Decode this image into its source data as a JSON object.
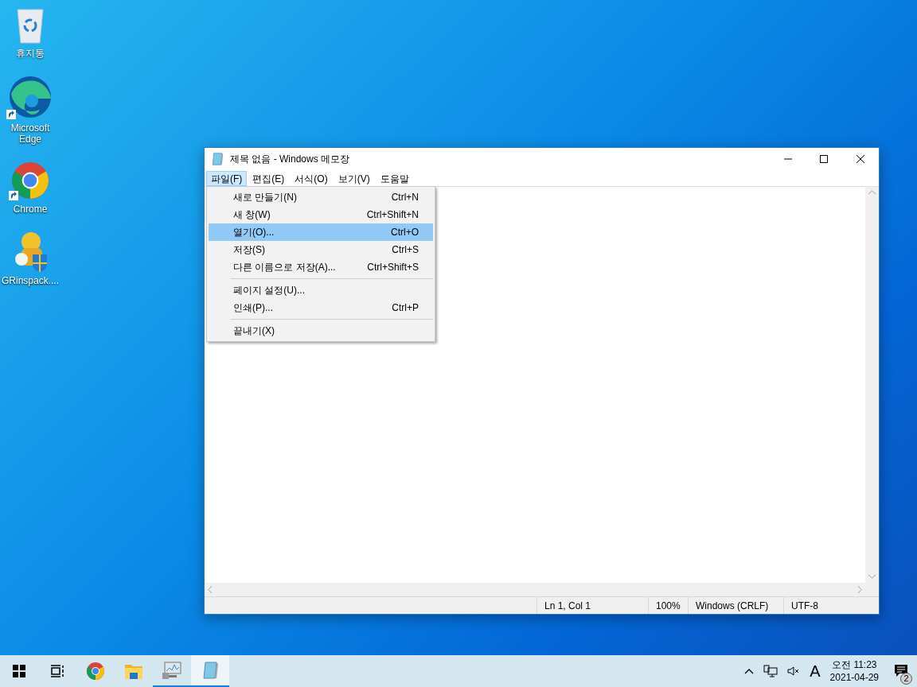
{
  "desktop_icons": [
    {
      "kind": "recycle",
      "label": "휴지통",
      "shortcut": false
    },
    {
      "kind": "edge",
      "label": "Microsoft Edge",
      "shortcut": true
    },
    {
      "kind": "chrome",
      "label": "Chrome",
      "shortcut": true
    },
    {
      "kind": "app",
      "label": "GRinspack....",
      "shortcut": false
    }
  ],
  "window": {
    "title": "제목 없음 - Windows 메모장"
  },
  "menu_bar": [
    {
      "label": "파일(F)",
      "selected": true
    },
    {
      "label": "편집(E)",
      "selected": false
    },
    {
      "label": "서식(O)",
      "selected": false
    },
    {
      "label": "보기(V)",
      "selected": false
    },
    {
      "label": "도움말",
      "selected": false
    }
  ],
  "file_menu": [
    {
      "kind": "item",
      "label": "새로 만들기(N)",
      "shortcut": "Ctrl+N",
      "selected": false
    },
    {
      "kind": "item",
      "label": "새 창(W)",
      "shortcut": "Ctrl+Shift+N",
      "selected": false
    },
    {
      "kind": "item",
      "label": "열기(O)...",
      "shortcut": "Ctrl+O",
      "selected": true
    },
    {
      "kind": "item",
      "label": "저장(S)",
      "shortcut": "Ctrl+S",
      "selected": false
    },
    {
      "kind": "item",
      "label": "다른 이름으로 저장(A)...",
      "shortcut": "Ctrl+Shift+S",
      "selected": false
    },
    {
      "kind": "separator"
    },
    {
      "kind": "item",
      "label": "페이지 설정(U)...",
      "selected": false
    },
    {
      "kind": "item",
      "label": "인쇄(P)...",
      "shortcut": "Ctrl+P",
      "selected": false
    },
    {
      "kind": "separator"
    },
    {
      "kind": "item",
      "label": "끝내기(X)",
      "selected": false
    }
  ],
  "status_bar": [
    "Ln 1, Col 1",
    "100%",
    "Windows (CRLF)",
    "UTF-8"
  ],
  "taskbar": {
    "apps": [
      {
        "kind": "start",
        "running": false,
        "active": false
      },
      {
        "kind": "taskview",
        "running": false,
        "active": false
      },
      {
        "kind": "chrome",
        "running": false,
        "active": false
      },
      {
        "kind": "folder",
        "running": false,
        "active": false
      },
      {
        "kind": "monitor",
        "running": true,
        "active": false
      },
      {
        "kind": "notepad",
        "running": true,
        "active": true
      }
    ],
    "ime": "A",
    "time": "오전 11:23",
    "date": "2021-04-29",
    "notifications": "2"
  }
}
